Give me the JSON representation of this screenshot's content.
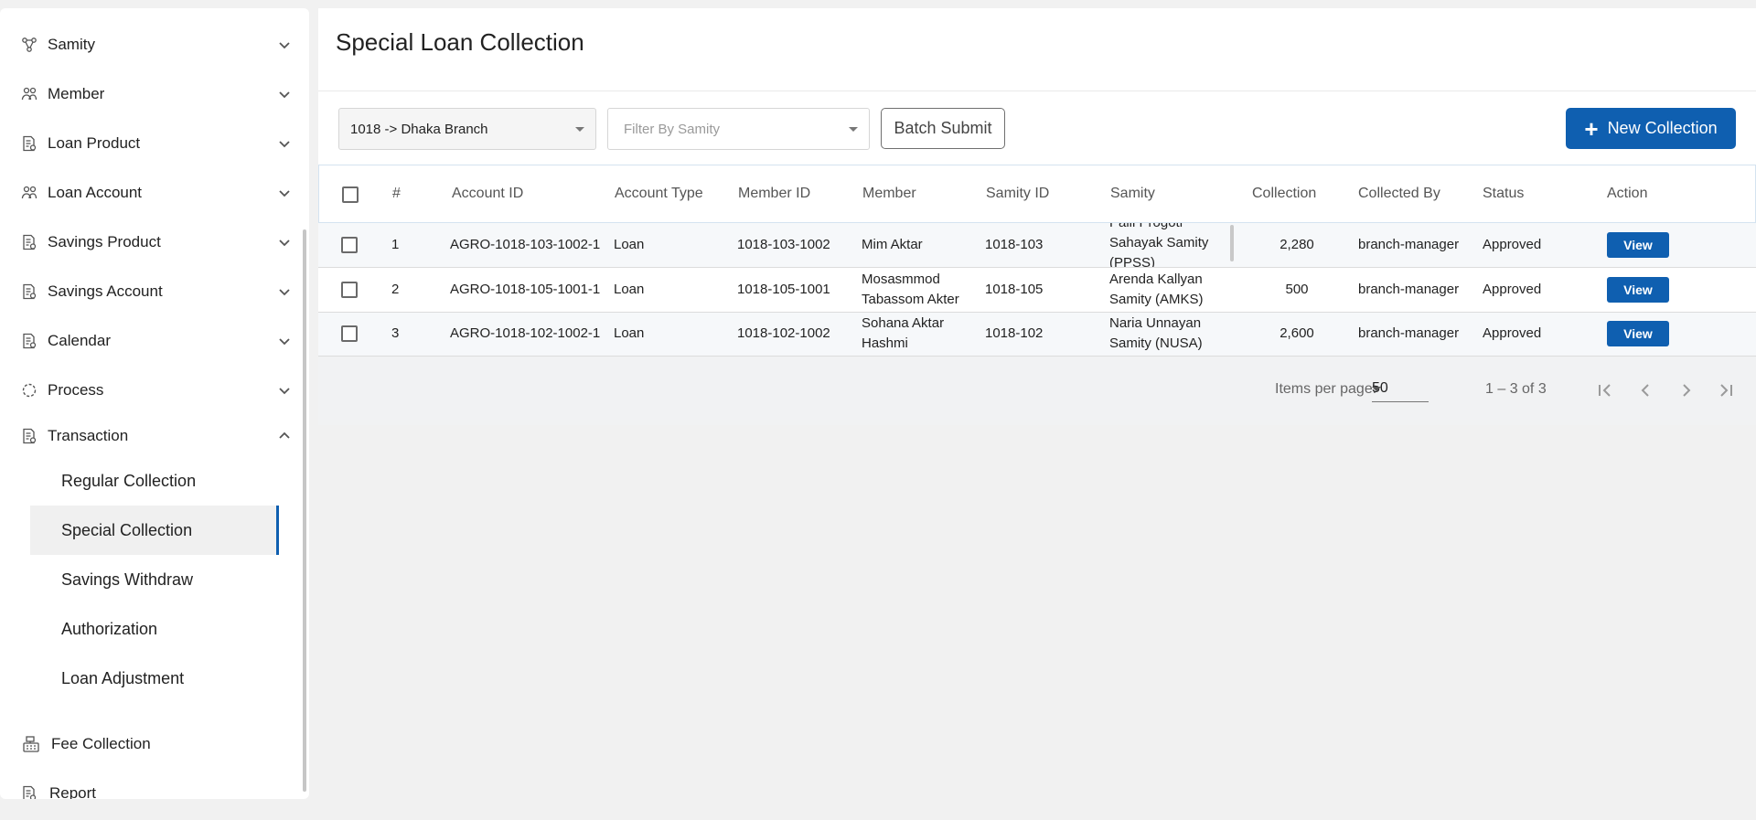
{
  "sidebar": {
    "items": [
      {
        "label": "Samity",
        "icon": "network-icon",
        "expanded": false
      },
      {
        "label": "Member",
        "icon": "users-icon",
        "expanded": false
      },
      {
        "label": "Loan Product",
        "icon": "document-icon",
        "expanded": false
      },
      {
        "label": "Loan Account",
        "icon": "users-icon",
        "expanded": false
      },
      {
        "label": "Savings Product",
        "icon": "document-icon",
        "expanded": false
      },
      {
        "label": "Savings Account",
        "icon": "document-icon",
        "expanded": false
      },
      {
        "label": "Calendar",
        "icon": "document-icon",
        "expanded": false
      },
      {
        "label": "Process",
        "icon": "spinner-icon",
        "expanded": false
      },
      {
        "label": "Transaction",
        "icon": "document-icon",
        "expanded": true
      }
    ],
    "sub_items": [
      {
        "label": "Regular Collection",
        "active": false
      },
      {
        "label": "Special Collection",
        "active": true
      },
      {
        "label": "Savings Withdraw",
        "active": false
      },
      {
        "label": "Authorization",
        "active": false
      },
      {
        "label": "Loan Adjustment",
        "active": false
      }
    ],
    "bottom_items": [
      {
        "label": "Fee Collection",
        "icon": "cash-register-icon"
      },
      {
        "label": "Report",
        "icon": "document-icon"
      }
    ]
  },
  "page": {
    "title": "Special Loan Collection"
  },
  "filters": {
    "branch_value": "1018 -> Dhaka Branch",
    "samity_placeholder": "Filter By Samity",
    "batch_submit_label": "Batch Submit",
    "new_collection_label": "New Collection"
  },
  "table": {
    "headers": [
      "#",
      "Account ID",
      "Account Type",
      "Member ID",
      "Member",
      "Samity ID",
      "Samity",
      "Collection",
      "Collected By",
      "Status",
      "Action"
    ],
    "rows": [
      {
        "no": "1",
        "account_id": "AGRO-1018-103-1002-1",
        "account_type": "Loan",
        "member_id": "1018-103-1002",
        "member": [
          "Mim Aktar"
        ],
        "samity_id": "1018-103",
        "samity": [
          "Palli Progoti",
          "Sahayak Samity",
          "(PPSS)"
        ],
        "collection": "2,280",
        "collected_by": "branch-manager",
        "status": "Approved",
        "action": "View"
      },
      {
        "no": "2",
        "account_id": "AGRO-1018-105-1001-1",
        "account_type": "Loan",
        "member_id": "1018-105-1001",
        "member": [
          "Mosasmmod",
          "Tabassom Akter"
        ],
        "samity_id": "1018-105",
        "samity": [
          "Arenda Kallyan",
          "Samity (AMKS)"
        ],
        "collection": "500",
        "collected_by": "branch-manager",
        "status": "Approved",
        "action": "View"
      },
      {
        "no": "3",
        "account_id": "AGRO-1018-102-1002-1",
        "account_type": "Loan",
        "member_id": "1018-102-1002",
        "member": [
          "Sohana Aktar",
          "Hashmi"
        ],
        "samity_id": "1018-102",
        "samity": [
          "Naria Unnayan",
          "Samity (NUSA)"
        ],
        "collection": "2,600",
        "collected_by": "branch-manager",
        "status": "Approved",
        "action": "View"
      }
    ]
  },
  "paginator": {
    "items_per_page_label": "Items per page:",
    "items_per_page_value": "50",
    "range_label": "1 – 3 of 3"
  },
  "colors": {
    "primary": "#0f5fb0",
    "page_background": "#f1f1f1",
    "header_border": "#d4e3f0"
  }
}
